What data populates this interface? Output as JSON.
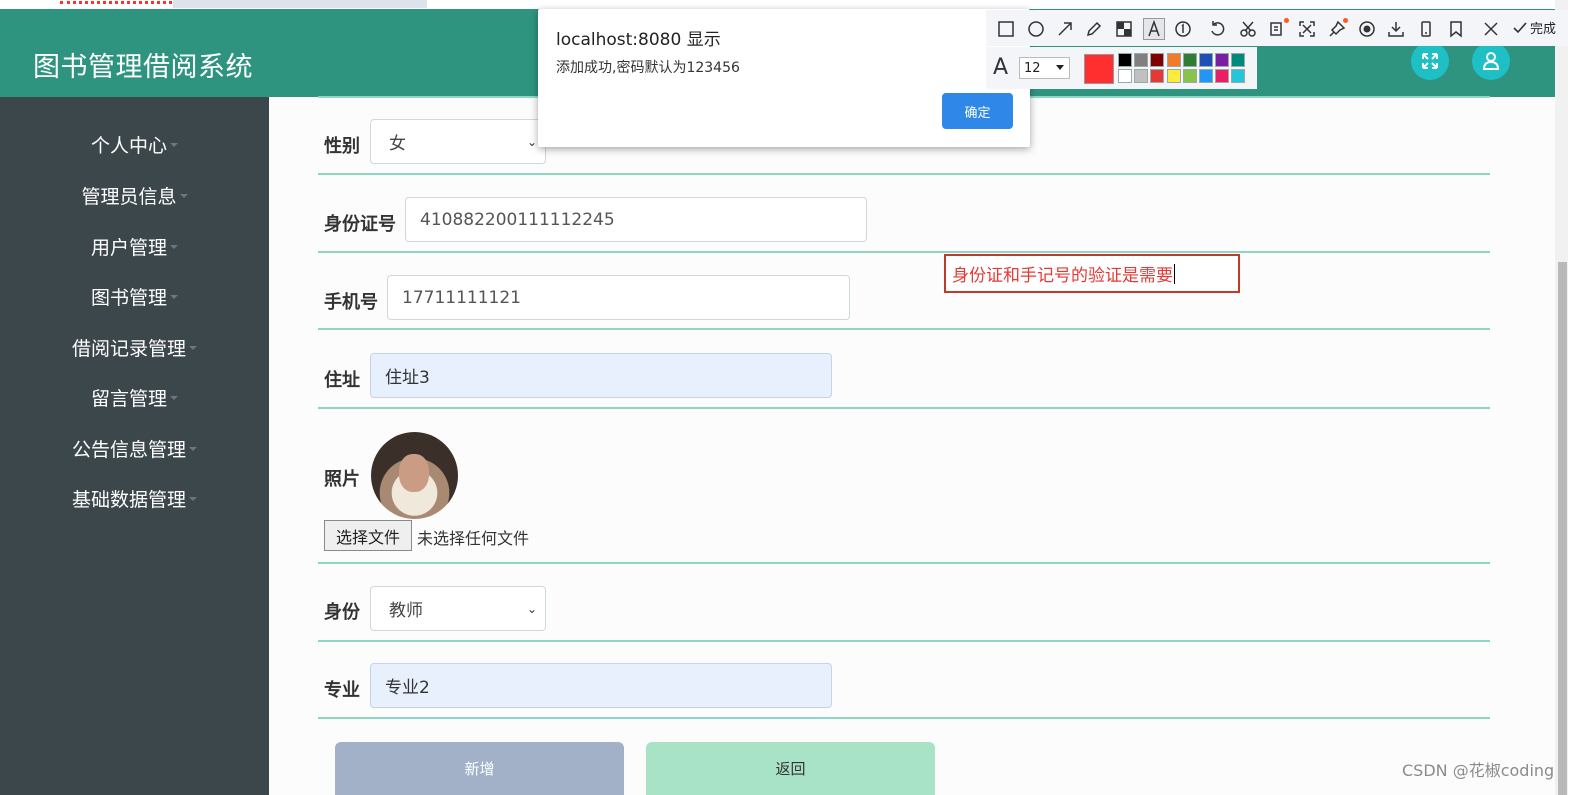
{
  "app": {
    "title": "图书管理借阅系统"
  },
  "sidebar": {
    "items": [
      {
        "label": "个人中心"
      },
      {
        "label": "管理员信息"
      },
      {
        "label": "用户管理"
      },
      {
        "label": "图书管理"
      },
      {
        "label": "借阅记录管理"
      },
      {
        "label": "留言管理"
      },
      {
        "label": "公告信息管理"
      },
      {
        "label": "基础数据管理"
      }
    ]
  },
  "form": {
    "gender": {
      "label": "性别",
      "value": "女"
    },
    "id_card": {
      "label": "身份证号",
      "value": "410882200111112245"
    },
    "phone": {
      "label": "手机号",
      "value": "17711111121"
    },
    "address": {
      "label": "住址",
      "value": "住址3"
    },
    "photo": {
      "label": "照片",
      "choose_button": "选择文件",
      "no_file": "未选择任何文件"
    },
    "identity": {
      "label": "身份",
      "value": "教师"
    },
    "major": {
      "label": "专业",
      "value": "专业2"
    },
    "add_button": "新增",
    "back_button": "返回"
  },
  "dialog": {
    "title": "localhost:8080 显示",
    "message": "添加成功,密码默认为123456",
    "ok_button": "确定"
  },
  "annotation": {
    "text": "身份证和手记号的验证是需要"
  },
  "screenshot_toolbar": {
    "done_label": "完成",
    "font_size": "12",
    "current_color": "#ff2f2f",
    "palette_top": [
      "#000000",
      "#808080",
      "#800000",
      "#f07c2a",
      "#2e7d32",
      "#1f4fb5",
      "#7b1fa2",
      "#00897b"
    ],
    "palette_bottom": [
      "#ffffff",
      "#c0c0c0",
      "#e53935",
      "#ffeb3b",
      "#8bc34a",
      "#2196f3",
      "#e91e63",
      "#26c6da"
    ]
  },
  "colors": {
    "header": "#2e9480",
    "sidebar": "#3c474c",
    "accent_button": "#1fbfc6",
    "row_line": "#8fd7c4"
  },
  "watermark": "CSDN @花椒coding"
}
